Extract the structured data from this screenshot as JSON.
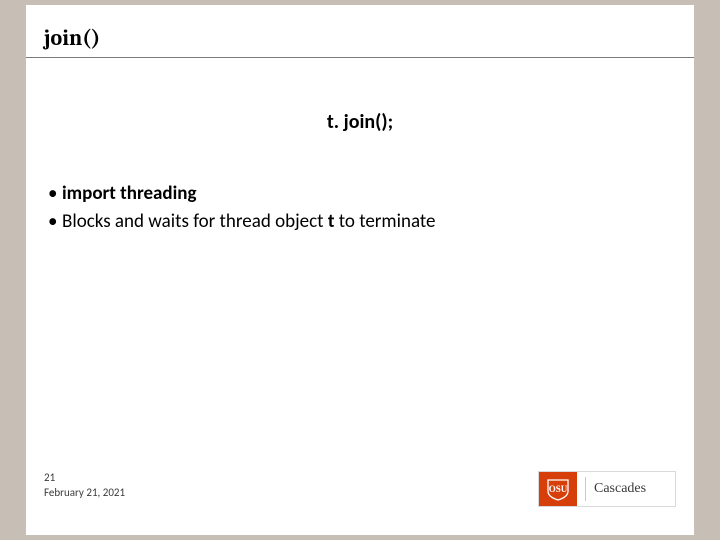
{
  "header": {
    "title": "join()"
  },
  "main": {
    "code": "t. join();",
    "bullet1": "import threading",
    "bullet2a": "Blocks and waits for thread object ",
    "bullet2b": "t",
    "bullet2c": " to terminate"
  },
  "footer": {
    "slide_number": "21",
    "date": "February 21, 2021"
  },
  "logo": {
    "abbrev": "OSU",
    "name": "Cascades"
  }
}
